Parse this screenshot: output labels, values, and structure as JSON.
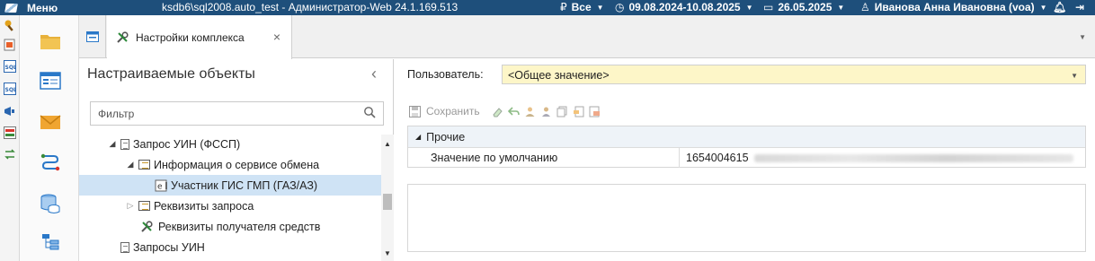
{
  "titlebar": {
    "menu_label": "Меню",
    "window_title": "ksdb6\\sql2008.auto_test - Администратор-Web 24.1.169.513",
    "budget_label": "Все",
    "period_label": "09.08.2024-10.08.2025",
    "date_label": "26.05.2025",
    "user_label": "Иванова Анна Ивановна (voa)"
  },
  "tabs": [
    {
      "label": "Настройки комплекса"
    }
  ],
  "left_panel": {
    "title": "Настраиваемые объекты",
    "filter_placeholder": "Фильтр",
    "tree": [
      {
        "label": "Запрос УИН (ФССП)",
        "icon": "document-icon",
        "expanded": true
      },
      {
        "label": "Информация о сервисе обмена",
        "icon": "table-icon",
        "expanded": true
      },
      {
        "label": "Участник ГИС ГМП (ГАЗ/АЗ)",
        "icon": "parameter-icon",
        "selected": true
      },
      {
        "label": "Реквизиты запроса",
        "icon": "table-icon",
        "expanded": false
      },
      {
        "label": "Реквизиты получателя средств",
        "icon": "tools-icon"
      },
      {
        "label": "Запросы УИН",
        "icon": "document-icon"
      }
    ]
  },
  "right_panel": {
    "user_label": "Пользователь:",
    "user_value": "<Общее значение>",
    "save_label": "Сохранить",
    "group_label": "Прочие",
    "property_name": "Значение по умолчанию",
    "property_value": "1654004615"
  },
  "colors": {
    "titlebar": "#1e4f7b",
    "selection": "#cfe3f5",
    "user_select_bg": "#fdf6c8",
    "group_bg": "#eef3f8"
  }
}
